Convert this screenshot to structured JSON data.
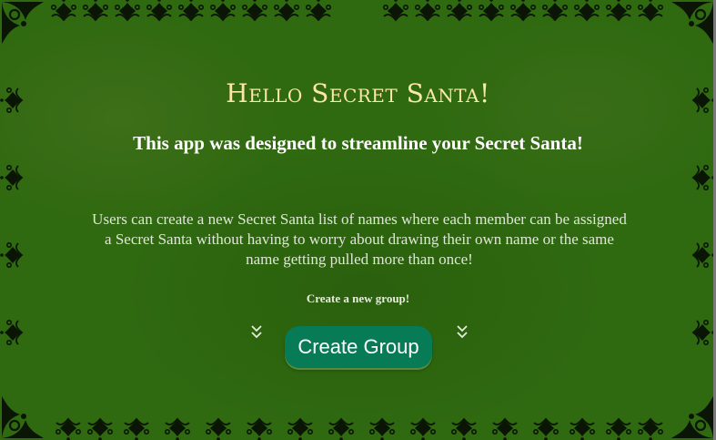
{
  "hero": {
    "title": "Hello Secret Santa!",
    "subtitle": "This app was designed to streamline your Secret Santa!",
    "description": "Users can create a new Secret Santa list of names where each member can be assigned a Secret Santa without having to worry about drawing their own name or the same name getting pulled more than once!",
    "cta_label": "Create a new group!",
    "create_button_label": "Create Group"
  },
  "icons": {
    "left_pointer": "chevron-double-down-icon",
    "right_pointer": "chevron-double-down-icon",
    "border": "ornamental-border"
  },
  "colors": {
    "background": "#2f6910",
    "title": "#fbe7a6",
    "subtitle": "#ffffff",
    "body_text": "#e0e6d8",
    "button": "#077a56",
    "button_text": "#ffffff",
    "ornament": "#0b1506"
  }
}
